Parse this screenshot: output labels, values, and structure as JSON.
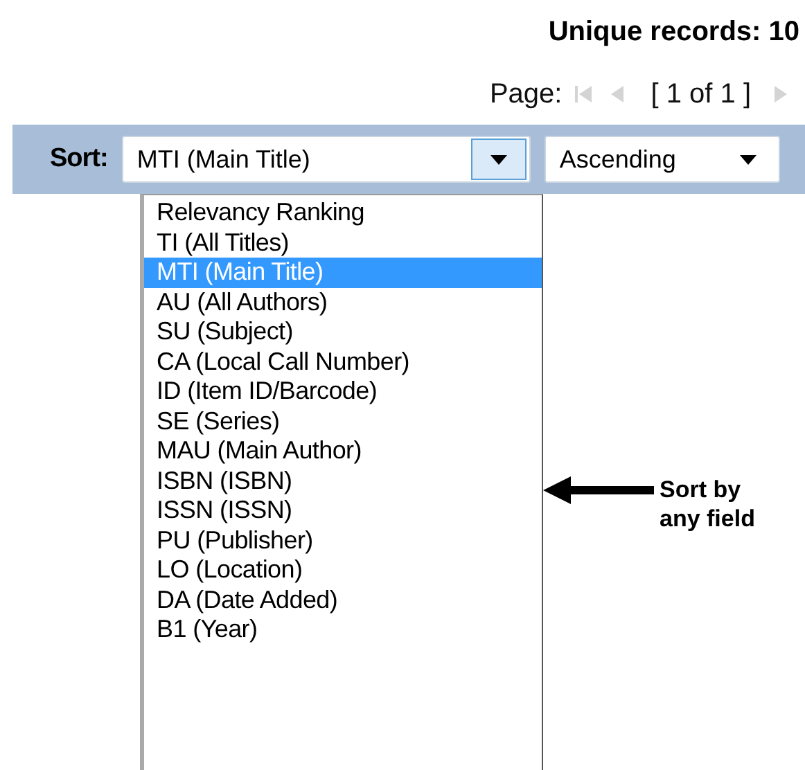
{
  "summary": {
    "unique_records": "Unique records: 10"
  },
  "pager": {
    "label": "Page:",
    "first": {
      "disabled": true
    },
    "previous": {
      "disabled": true
    },
    "position": "[ 1 of 1 ]",
    "next": {
      "disabled": true
    }
  },
  "sort_bar": {
    "label": "Sort:",
    "field_select": {
      "value": "MTI (Main Title)",
      "expanded": true,
      "options": [
        {
          "label": "Relevancy Ranking",
          "selected": false
        },
        {
          "label": "TI (All Titles)",
          "selected": false
        },
        {
          "label": "MTI (Main Title)",
          "selected": true
        },
        {
          "label": "AU (All Authors)",
          "selected": false
        },
        {
          "label": "SU (Subject)",
          "selected": false
        },
        {
          "label": "CA (Local Call Number)",
          "selected": false
        },
        {
          "label": "ID (Item ID/Barcode)",
          "selected": false
        },
        {
          "label": "SE (Series)",
          "selected": false
        },
        {
          "label": "MAU (Main Author)",
          "selected": false
        },
        {
          "label": "ISBN (ISBN)",
          "selected": false
        },
        {
          "label": "ISSN (ISSN)",
          "selected": false
        },
        {
          "label": "PU (Publisher)",
          "selected": false
        },
        {
          "label": "LO (Location)",
          "selected": false
        },
        {
          "label": "DA (Date Added)",
          "selected": false
        },
        {
          "label": "B1 (Year)",
          "selected": false
        }
      ]
    },
    "order_select": {
      "value": "Ascending",
      "expanded": false
    }
  },
  "annotation": {
    "text": "Sort by any field"
  }
}
